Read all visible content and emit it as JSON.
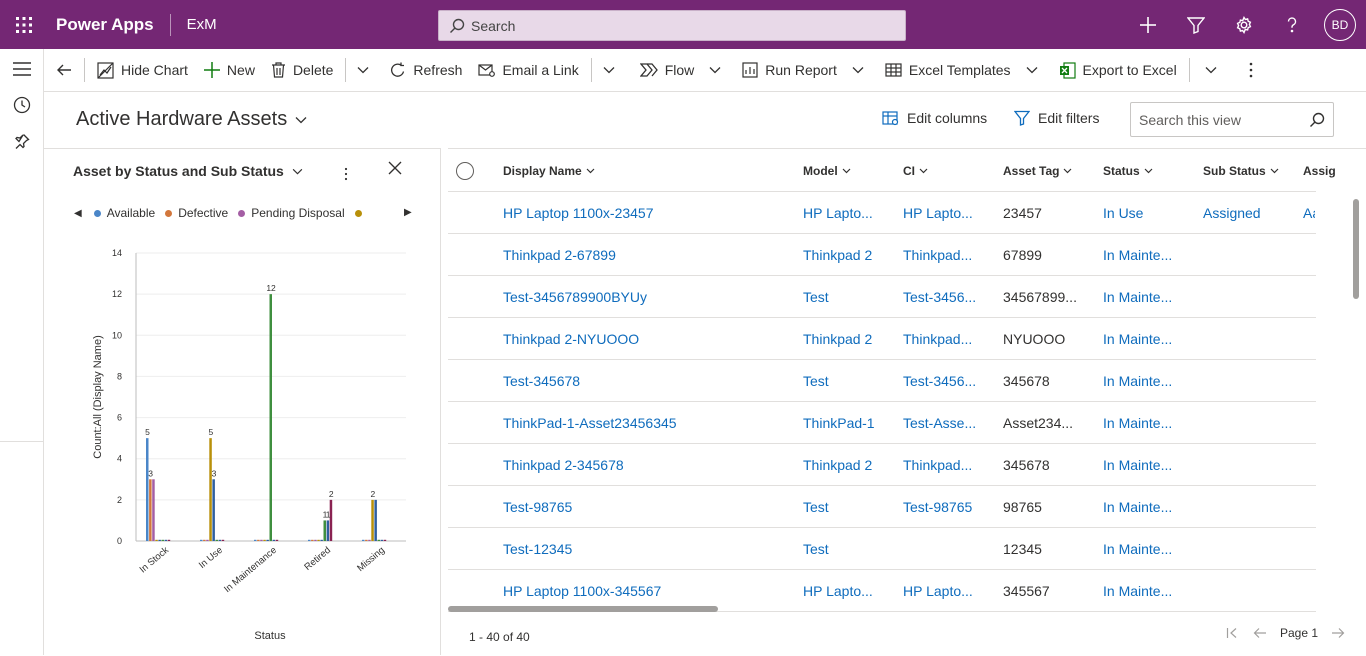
{
  "topbar": {
    "app_name": "Power Apps",
    "environment": "ExM",
    "search_placeholder": "Search",
    "avatar_initials": "BD",
    "color": "#742774"
  },
  "commandbar": {
    "hide_chart": "Hide Chart",
    "new": "New",
    "delete": "Delete",
    "refresh": "Refresh",
    "email_link": "Email a Link",
    "flow": "Flow",
    "run_report": "Run Report",
    "excel_templates": "Excel Templates",
    "export_excel": "Export to Excel"
  },
  "view": {
    "title": "Active Hardware Assets",
    "edit_columns": "Edit columns",
    "edit_filters": "Edit filters",
    "search_placeholder": "Search this view"
  },
  "chart": {
    "title": "Asset by Status and Sub Status",
    "legend": [
      {
        "name": "Available",
        "color": "#4a86c8"
      },
      {
        "name": "Defective",
        "color": "#d2773c"
      },
      {
        "name": "Pending Disposal",
        "color": "#a45ea4"
      },
      {
        "name": "",
        "color": "#b8900a"
      }
    ]
  },
  "chart_data": {
    "type": "bar",
    "title": "Asset by Status and Sub Status",
    "xlabel": "Status",
    "ylabel": "Count:All (Display Name)",
    "ylim": [
      0,
      14
    ],
    "yticks": [
      0,
      2,
      4,
      6,
      8,
      10,
      12,
      14
    ],
    "categories": [
      "In Stock",
      "In Use",
      "In Maintenance",
      "Retired",
      "Missing"
    ],
    "series": [
      {
        "name": "Available",
        "color": "#4a86c8",
        "values": [
          5,
          0,
          0,
          0,
          0
        ]
      },
      {
        "name": "Defective",
        "color": "#d2773c",
        "values": [
          3,
          0,
          0,
          0,
          0
        ]
      },
      {
        "name": "Pending Disposal",
        "color": "#a45ea4",
        "values": [
          3,
          0,
          0,
          0,
          0
        ]
      },
      {
        "name": "",
        "color": "#b8900a",
        "values": [
          0,
          5,
          0,
          0,
          2
        ]
      },
      {
        "color": "#2f5f9e",
        "values": [
          0,
          3,
          0,
          0,
          2
        ]
      },
      {
        "color": "#3f8f3f",
        "values": [
          0,
          0,
          12,
          1,
          0
        ]
      },
      {
        "color": "#2f5f9e",
        "values": [
          0,
          0,
          0,
          1,
          0
        ]
      },
      {
        "color": "#8a2252",
        "values": [
          0,
          0,
          0,
          2,
          0
        ]
      }
    ],
    "data_labels": [
      {
        "category": "In Stock",
        "series": 0,
        "text": "5"
      },
      {
        "category": "In Stock",
        "series": 1,
        "text": "3"
      },
      {
        "category": "In Use",
        "series": 3,
        "text": "5"
      },
      {
        "category": "In Use",
        "series": 4,
        "text": "3"
      },
      {
        "category": "In Maintenance",
        "series": 5,
        "text": "12"
      },
      {
        "category": "Retired",
        "series": 5,
        "text": "1"
      },
      {
        "category": "Retired",
        "series": 6,
        "text": "1"
      },
      {
        "category": "Retired",
        "series": 7,
        "text": "2"
      },
      {
        "category": "Missing",
        "series": 3,
        "text": "2"
      }
    ],
    "grid": true
  },
  "grid": {
    "columns": [
      "Display Name",
      "Model",
      "CI",
      "Asset Tag",
      "Status",
      "Sub Status",
      "Assig"
    ],
    "rows": [
      [
        "HP Laptop 1100x-23457",
        "HP Lapto...",
        "HP Lapto...",
        "23457",
        "In Use",
        "Assigned",
        "Aa"
      ],
      [
        "Thinkpad 2-67899",
        "Thinkpad 2",
        "Thinkpad...",
        "67899",
        "In Mainte...",
        "",
        ""
      ],
      [
        "Test-3456789900BYUy",
        "Test",
        "Test-3456...",
        "34567899...",
        "In Mainte...",
        "",
        ""
      ],
      [
        "Thinkpad 2-NYUOOO",
        "Thinkpad 2",
        "Thinkpad...",
        "NYUOOO",
        "In Mainte...",
        "",
        ""
      ],
      [
        "Test-345678",
        "Test",
        "Test-3456...",
        "345678",
        "In Mainte...",
        "",
        ""
      ],
      [
        "ThinkPad-1-Asset23456345",
        "ThinkPad-1",
        "Test-Asse...",
        "Asset234...",
        "In Mainte...",
        "",
        ""
      ],
      [
        "Thinkpad 2-345678",
        "Thinkpad 2",
        "Thinkpad...",
        "345678",
        "In Mainte...",
        "",
        ""
      ],
      [
        "Test-98765",
        "Test",
        "Test-98765",
        "98765",
        "In Mainte...",
        "",
        ""
      ],
      [
        "Test-12345",
        "Test",
        "",
        "12345",
        "In Mainte...",
        "",
        ""
      ],
      [
        "HP Laptop 1100x-345567",
        "HP Lapto...",
        "HP Lapto...",
        "345567",
        "In Mainte...",
        "",
        ""
      ]
    ],
    "record_count": "1 - 40 of 40",
    "page_label": "Page 1"
  }
}
